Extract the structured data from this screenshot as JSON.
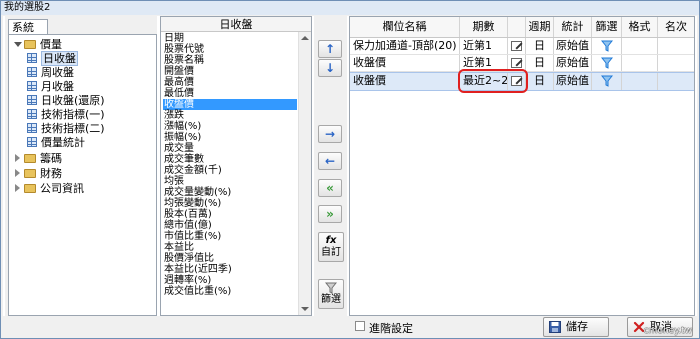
{
  "window": {
    "title": "我的選股2"
  },
  "left_panel": {
    "tab_label": "系統",
    "tree": [
      {
        "label": "價量",
        "kind": "folder",
        "expanded": true
      },
      {
        "label": "日收盤",
        "kind": "leaf",
        "selected": true
      },
      {
        "label": "周收盤",
        "kind": "leaf"
      },
      {
        "label": "月收盤",
        "kind": "leaf"
      },
      {
        "label": "日收盤(還原)",
        "kind": "leaf"
      },
      {
        "label": "技術指標(一)",
        "kind": "leaf"
      },
      {
        "label": "技術指標(二)",
        "kind": "leaf"
      },
      {
        "label": "價量統計",
        "kind": "leaf"
      },
      {
        "label": "籌碼",
        "kind": "folder",
        "expanded": false
      },
      {
        "label": "財務",
        "kind": "folder",
        "expanded": false
      },
      {
        "label": "公司資訊",
        "kind": "folder",
        "expanded": false
      }
    ]
  },
  "middle_list": {
    "header": "日收盤",
    "items": [
      "日期",
      "股票代號",
      "股票名稱",
      "開盤價",
      "最高價",
      "最低價",
      "收盤價",
      "漲跌",
      "漲幅(%)",
      "振幅(%)",
      "成交量",
      "成交筆數",
      "成交金額(千)",
      "均張",
      "成交量變動(%)",
      "均張變動(%)",
      "股本(百萬)",
      "總市值(億)",
      "市值比重(%)",
      "本益比",
      "股價淨值比",
      "本益比(近四季)",
      "週轉率(%)",
      "成交值比重(%)"
    ],
    "selected_index": 6
  },
  "buttons": {
    "move_up": "↑",
    "move_down": "↓",
    "add": "→",
    "remove": "←",
    "remove_all": "«",
    "add_all": "»",
    "custom_icon": "fx",
    "custom_label": "自訂",
    "filter_label": "篩選"
  },
  "grid": {
    "headers": [
      "欄位名稱",
      "期數",
      "",
      "週期",
      "統計",
      "篩選",
      "格式",
      "名次"
    ],
    "rows": [
      {
        "field": "保力加通道-頂部(20)",
        "period": "近第1",
        "cycle": "日",
        "stat": "原始值",
        "selected": false
      },
      {
        "field": "收盤價",
        "period": "近第1",
        "cycle": "日",
        "stat": "原始值",
        "selected": false
      },
      {
        "field": "收盤價",
        "period": "最近2~2",
        "cycle": "日",
        "stat": "原始值",
        "selected": true
      }
    ]
  },
  "bottom": {
    "advanced_label": "進階設定",
    "save_label": "儲存",
    "cancel_label": "取消",
    "watermark": "cmoney.tw"
  },
  "colors": {
    "selection_blue": "#3399ff",
    "highlight_red": "#e02020",
    "funnel_blue": "#1e78d6"
  }
}
